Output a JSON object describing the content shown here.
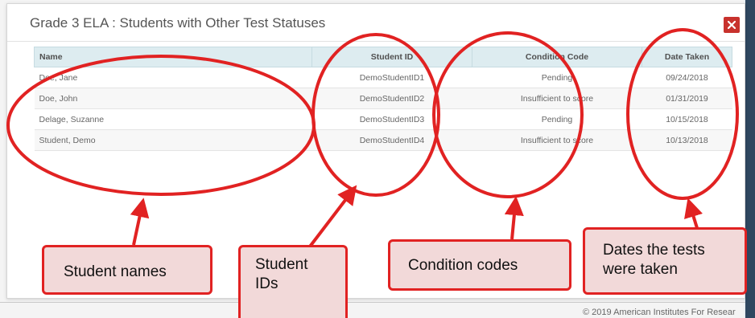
{
  "modal": {
    "title": "Grade 3 ELA : Students with Other Test Statuses",
    "close_icon": "close-icon",
    "close_color": "#c8322d"
  },
  "table": {
    "headers": {
      "name": "Name",
      "student_id": "Student ID",
      "condition_code": "Condition Code",
      "date_taken": "Date Taken"
    },
    "rows": [
      {
        "name": "Doe, Jane",
        "student_id": "DemoStudentID1",
        "condition_code": "Pending",
        "date_taken": "09/24/2018"
      },
      {
        "name": "Doe, John",
        "student_id": "DemoStudentID2",
        "condition_code": "Insufficient to score",
        "date_taken": "01/31/2019"
      },
      {
        "name": "Delage, Suzanne",
        "student_id": "DemoStudentID3",
        "condition_code": "Pending",
        "date_taken": "10/15/2018"
      },
      {
        "name": "Student, Demo",
        "student_id": "DemoStudentID4",
        "condition_code": "Insufficient to score",
        "date_taken": "10/13/2018"
      }
    ]
  },
  "callouts": {
    "names": "Student names",
    "ids_line1": "Student",
    "ids_line2": "IDs",
    "codes": "Condition codes",
    "dates_line1": "Dates the tests",
    "dates_line2": "were taken"
  },
  "footer": {
    "copyright": "© 2019 American Institutes For Resear"
  },
  "colors": {
    "annotation_red": "#e12222",
    "callout_fill": "#f2d9d9",
    "header_fill": "#ddecf0"
  }
}
